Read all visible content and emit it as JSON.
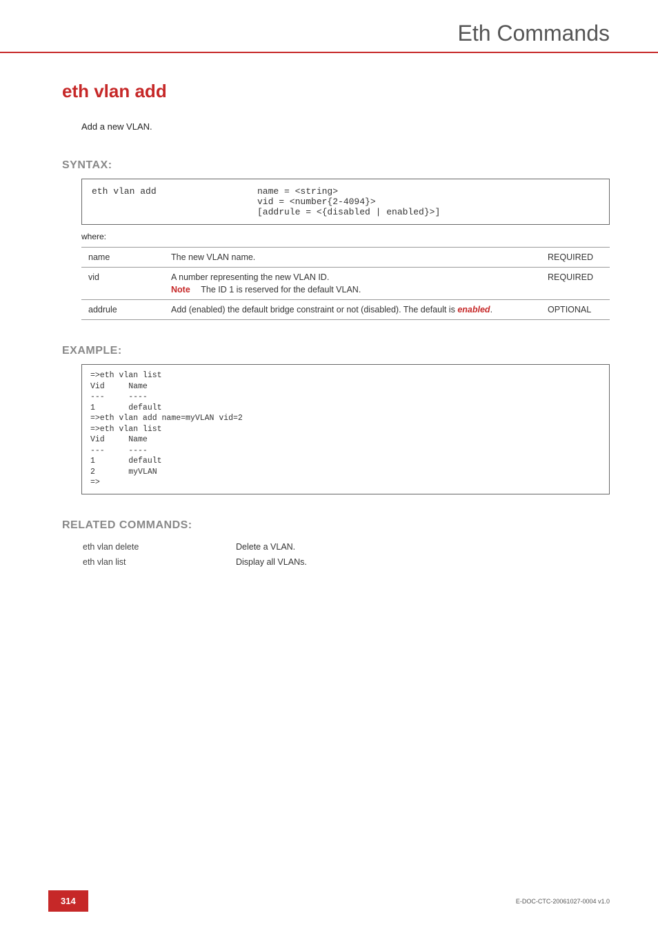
{
  "header": {
    "title": "Eth Commands"
  },
  "command": {
    "title": "eth vlan add",
    "description": "Add a new VLAN."
  },
  "syntax": {
    "heading": "SYNTAX:",
    "left": "eth vlan add",
    "right": "name = <string>\nvid = <number{2-4094}>\n[addrule = <{disabled | enabled}>]",
    "where": "where:"
  },
  "params": [
    {
      "name": "name",
      "desc": "The new VLAN name.",
      "note": "",
      "req": "REQUIRED"
    },
    {
      "name": "vid",
      "desc": "A number representing the new VLAN ID.",
      "note": "The ID 1 is reserved for the default VLAN.",
      "req": "REQUIRED"
    },
    {
      "name": "addrule",
      "desc_pre": "Add (enabled) the default bridge constraint or not (disabled). The default is ",
      "desc_emph": "enabled",
      "desc_post": ".",
      "note": "",
      "req": "OPTIONAL"
    }
  ],
  "labels": {
    "note": "Note"
  },
  "example": {
    "heading": "EXAMPLE:",
    "body": "=>eth vlan list\nVid     Name\n---     ----\n1       default\n=>eth vlan add name=myVLAN vid=2\n=>eth vlan list\nVid     Name\n---     ----\n1       default\n2       myVLAN\n=>"
  },
  "related": {
    "heading": "RELATED COMMANDS:",
    "rows": [
      {
        "cmd": "eth vlan delete",
        "desc": "Delete a VLAN."
      },
      {
        "cmd": "eth vlan list",
        "desc": "Display all VLANs."
      }
    ]
  },
  "footer": {
    "page": "314",
    "docid": "E-DOC-CTC-20061027-0004 v1.0"
  }
}
